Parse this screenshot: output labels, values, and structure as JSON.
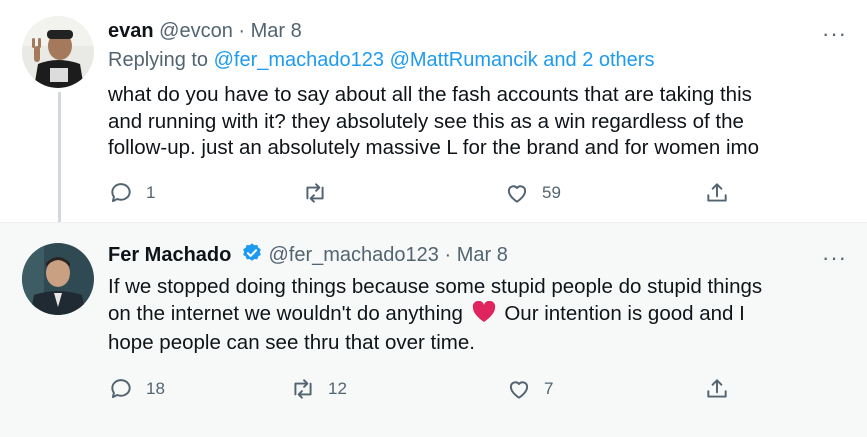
{
  "tweets": [
    {
      "name": "evan",
      "handle": "@evcon",
      "separator": "·",
      "date": "Mar 8",
      "replying_prefix": "Replying to",
      "replying_to": "@fer_machado123 @MattRumancik and 2 others",
      "text_lines": [
        "what do you have to say about all the fash accounts that are taking this",
        "and running with it? they absolutely see this as a win regardless of the",
        "follow-up. just an absolutely massive L for the brand and for women imo"
      ],
      "actions": {
        "reply": "1",
        "retweet": "",
        "like": "59"
      },
      "more": "···"
    },
    {
      "name": "Fer Machado",
      "verified": true,
      "handle": "@fer_machado123",
      "separator": "·",
      "date": "Mar 8",
      "text_line1": "If we stopped doing things because some stupid people do stupid things",
      "text_line2_a": "on the internet we wouldn't do anything",
      "text_line2_emoji": "heart",
      "text_line2_b": "Our intention is good and I",
      "text_line3": "hope people can see thru that over time.",
      "actions": {
        "reply": "18",
        "retweet": "12",
        "like": "7"
      },
      "more": "···"
    }
  ],
  "colors": {
    "link": "#1d9bf0",
    "secondary_text": "#536471",
    "verified": "#1d9bf0",
    "heart_emoji": "#e0245e",
    "highlight_bg": "#f7f9f9"
  }
}
